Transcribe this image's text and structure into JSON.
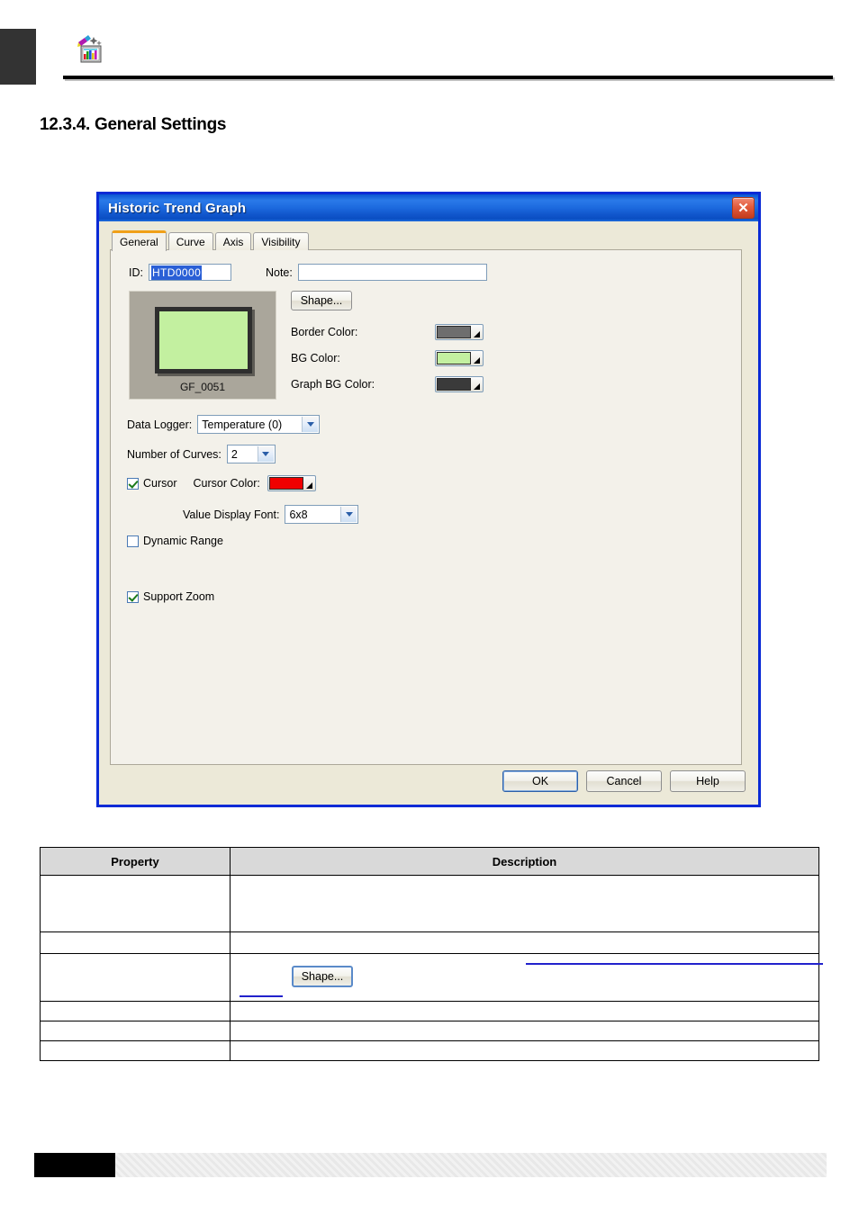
{
  "page": {
    "section_number_title": "12.3.4. General Settings",
    "header_icon": "palette-graph-icon"
  },
  "dialog": {
    "title": "Historic Trend Graph",
    "close_icon": "close-icon",
    "tabs": [
      {
        "label": "General",
        "active": true
      },
      {
        "label": "Curve",
        "active": false
      },
      {
        "label": "Axis",
        "active": false
      },
      {
        "label": "Visibility",
        "active": false
      }
    ],
    "fields": {
      "id_label": "ID:",
      "id_value": "HTD0000",
      "note_label": "Note:",
      "note_value": "",
      "note_placeholder": ""
    },
    "shape": {
      "preview_caption": "GF_0051",
      "shape_button_label": "Shape...",
      "border_color_label": "Border Color:",
      "border_color": "#6e6e6e",
      "bg_color_label": "BG Color:",
      "bg_color": "#c3f0a0",
      "graph_bg_color_label": "Graph BG Color:",
      "graph_bg_color": "#3a3a3a",
      "preview_bg": "#aaa69b",
      "preview_fill": "#c3f0a0",
      "preview_frame": "#2e2e2e"
    },
    "settings": {
      "data_logger_label": "Data Logger:",
      "data_logger_value": "Temperature (0)",
      "number_of_curves_label": "Number of Curves:",
      "number_of_curves_value": "2",
      "cursor_label": "Cursor",
      "cursor_checked": true,
      "cursor_color_label": "Cursor Color:",
      "cursor_color": "#f00000",
      "value_display_font_label": "Value Display Font:",
      "value_display_font_value": "6x8",
      "dynamic_range_label": "Dynamic Range",
      "dynamic_range_checked": false,
      "support_zoom_label": "Support Zoom",
      "support_zoom_checked": true
    },
    "buttons": {
      "ok": "OK",
      "cancel": "Cancel",
      "help": "Help"
    },
    "colors": {
      "titlebar_blue": "#1e6ce0",
      "dialog_border": "#0a2ad6",
      "active_tab_accent": "#f0a018",
      "face": "#ece9d8"
    }
  },
  "property_table": {
    "headers": [
      "Property",
      "Description"
    ],
    "rows": [
      {
        "property": "",
        "description": ""
      },
      {
        "property": "",
        "description": ""
      },
      {
        "property": "",
        "description": "",
        "has_shape_button": true,
        "shape_button_label": "Shape..."
      },
      {
        "property": "",
        "description": ""
      },
      {
        "property": "",
        "description": ""
      },
      {
        "property": "",
        "description": ""
      }
    ]
  }
}
